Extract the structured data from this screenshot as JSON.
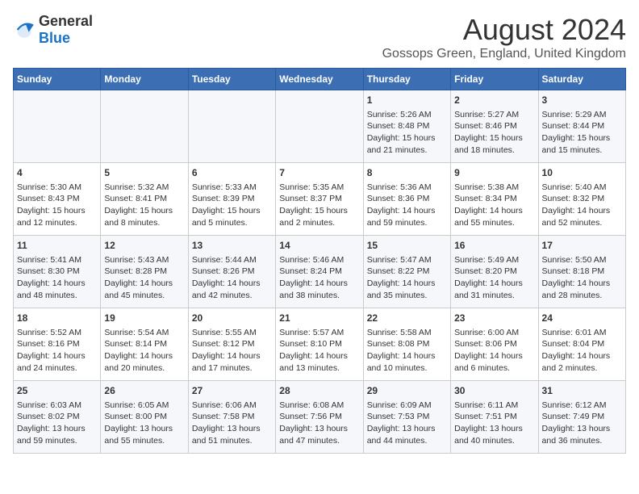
{
  "logo": {
    "general": "General",
    "blue": "Blue"
  },
  "title": "August 2024",
  "subtitle": "Gossops Green, England, United Kingdom",
  "headers": [
    "Sunday",
    "Monday",
    "Tuesday",
    "Wednesday",
    "Thursday",
    "Friday",
    "Saturday"
  ],
  "weeks": [
    [
      {
        "day": "",
        "content": ""
      },
      {
        "day": "",
        "content": ""
      },
      {
        "day": "",
        "content": ""
      },
      {
        "day": "",
        "content": ""
      },
      {
        "day": "1",
        "content": "Sunrise: 5:26 AM\nSunset: 8:48 PM\nDaylight: 15 hours\nand 21 minutes."
      },
      {
        "day": "2",
        "content": "Sunrise: 5:27 AM\nSunset: 8:46 PM\nDaylight: 15 hours\nand 18 minutes."
      },
      {
        "day": "3",
        "content": "Sunrise: 5:29 AM\nSunset: 8:44 PM\nDaylight: 15 hours\nand 15 minutes."
      }
    ],
    [
      {
        "day": "4",
        "content": "Sunrise: 5:30 AM\nSunset: 8:43 PM\nDaylight: 15 hours\nand 12 minutes."
      },
      {
        "day": "5",
        "content": "Sunrise: 5:32 AM\nSunset: 8:41 PM\nDaylight: 15 hours\nand 8 minutes."
      },
      {
        "day": "6",
        "content": "Sunrise: 5:33 AM\nSunset: 8:39 PM\nDaylight: 15 hours\nand 5 minutes."
      },
      {
        "day": "7",
        "content": "Sunrise: 5:35 AM\nSunset: 8:37 PM\nDaylight: 15 hours\nand 2 minutes."
      },
      {
        "day": "8",
        "content": "Sunrise: 5:36 AM\nSunset: 8:36 PM\nDaylight: 14 hours\nand 59 minutes."
      },
      {
        "day": "9",
        "content": "Sunrise: 5:38 AM\nSunset: 8:34 PM\nDaylight: 14 hours\nand 55 minutes."
      },
      {
        "day": "10",
        "content": "Sunrise: 5:40 AM\nSunset: 8:32 PM\nDaylight: 14 hours\nand 52 minutes."
      }
    ],
    [
      {
        "day": "11",
        "content": "Sunrise: 5:41 AM\nSunset: 8:30 PM\nDaylight: 14 hours\nand 48 minutes."
      },
      {
        "day": "12",
        "content": "Sunrise: 5:43 AM\nSunset: 8:28 PM\nDaylight: 14 hours\nand 45 minutes."
      },
      {
        "day": "13",
        "content": "Sunrise: 5:44 AM\nSunset: 8:26 PM\nDaylight: 14 hours\nand 42 minutes."
      },
      {
        "day": "14",
        "content": "Sunrise: 5:46 AM\nSunset: 8:24 PM\nDaylight: 14 hours\nand 38 minutes."
      },
      {
        "day": "15",
        "content": "Sunrise: 5:47 AM\nSunset: 8:22 PM\nDaylight: 14 hours\nand 35 minutes."
      },
      {
        "day": "16",
        "content": "Sunrise: 5:49 AM\nSunset: 8:20 PM\nDaylight: 14 hours\nand 31 minutes."
      },
      {
        "day": "17",
        "content": "Sunrise: 5:50 AM\nSunset: 8:18 PM\nDaylight: 14 hours\nand 28 minutes."
      }
    ],
    [
      {
        "day": "18",
        "content": "Sunrise: 5:52 AM\nSunset: 8:16 PM\nDaylight: 14 hours\nand 24 minutes."
      },
      {
        "day": "19",
        "content": "Sunrise: 5:54 AM\nSunset: 8:14 PM\nDaylight: 14 hours\nand 20 minutes."
      },
      {
        "day": "20",
        "content": "Sunrise: 5:55 AM\nSunset: 8:12 PM\nDaylight: 14 hours\nand 17 minutes."
      },
      {
        "day": "21",
        "content": "Sunrise: 5:57 AM\nSunset: 8:10 PM\nDaylight: 14 hours\nand 13 minutes."
      },
      {
        "day": "22",
        "content": "Sunrise: 5:58 AM\nSunset: 8:08 PM\nDaylight: 14 hours\nand 10 minutes."
      },
      {
        "day": "23",
        "content": "Sunrise: 6:00 AM\nSunset: 8:06 PM\nDaylight: 14 hours\nand 6 minutes."
      },
      {
        "day": "24",
        "content": "Sunrise: 6:01 AM\nSunset: 8:04 PM\nDaylight: 14 hours\nand 2 minutes."
      }
    ],
    [
      {
        "day": "25",
        "content": "Sunrise: 6:03 AM\nSunset: 8:02 PM\nDaylight: 13 hours\nand 59 minutes."
      },
      {
        "day": "26",
        "content": "Sunrise: 6:05 AM\nSunset: 8:00 PM\nDaylight: 13 hours\nand 55 minutes."
      },
      {
        "day": "27",
        "content": "Sunrise: 6:06 AM\nSunset: 7:58 PM\nDaylight: 13 hours\nand 51 minutes."
      },
      {
        "day": "28",
        "content": "Sunrise: 6:08 AM\nSunset: 7:56 PM\nDaylight: 13 hours\nand 47 minutes."
      },
      {
        "day": "29",
        "content": "Sunrise: 6:09 AM\nSunset: 7:53 PM\nDaylight: 13 hours\nand 44 minutes."
      },
      {
        "day": "30",
        "content": "Sunrise: 6:11 AM\nSunset: 7:51 PM\nDaylight: 13 hours\nand 40 minutes."
      },
      {
        "day": "31",
        "content": "Sunrise: 6:12 AM\nSunset: 7:49 PM\nDaylight: 13 hours\nand 36 minutes."
      }
    ]
  ]
}
